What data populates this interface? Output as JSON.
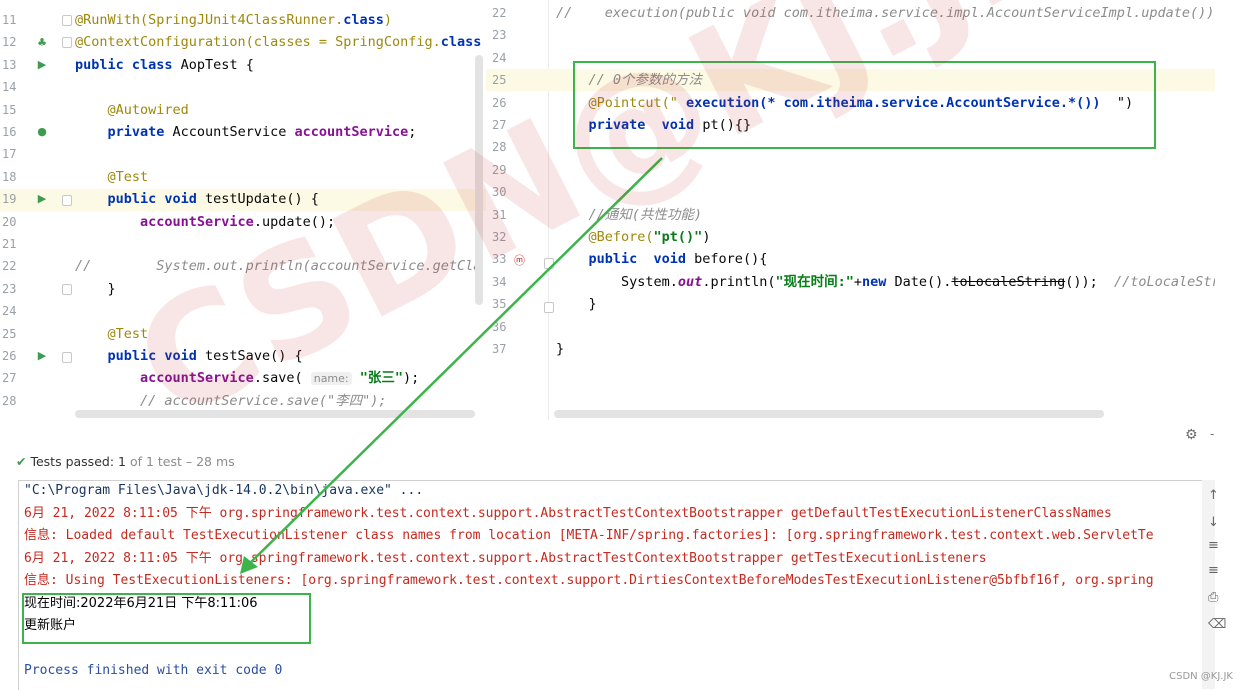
{
  "left_editor": {
    "lines": [
      {
        "num": "11",
        "parts": [
          {
            "t": "@RunWith(SpringJUnit4ClassRunner.",
            "c": "ann"
          },
          {
            "t": "class",
            "c": "kw"
          },
          {
            "t": ")",
            "c": "ann"
          }
        ]
      },
      {
        "num": "12",
        "parts": [
          {
            "t": "@ContextConfiguration(classes = SpringConfig.",
            "c": "ann"
          },
          {
            "t": "class",
            "c": "kw"
          }
        ]
      },
      {
        "num": "13",
        "parts": [
          {
            "t": "public class ",
            "c": "kw"
          },
          {
            "t": "AopTest {",
            "c": ""
          }
        ]
      },
      {
        "num": "14",
        "parts": []
      },
      {
        "num": "15",
        "parts": [
          {
            "t": "    @Autowired",
            "c": "ann"
          }
        ]
      },
      {
        "num": "16",
        "parts": [
          {
            "t": "    private ",
            "c": "kw"
          },
          {
            "t": "AccountService ",
            "c": ""
          },
          {
            "t": "accountService",
            "c": "fld"
          },
          {
            "t": ";",
            "c": ""
          }
        ]
      },
      {
        "num": "17",
        "parts": []
      },
      {
        "num": "18",
        "parts": [
          {
            "t": "    @Test",
            "c": "ann"
          }
        ]
      },
      {
        "num": "19",
        "parts": [
          {
            "t": "    public void ",
            "c": "kw"
          },
          {
            "t": "testUpdate() {",
            "c": ""
          }
        ]
      },
      {
        "num": "20",
        "parts": [
          {
            "t": "        accountService",
            "c": "fld"
          },
          {
            "t": ".update();",
            "c": ""
          }
        ]
      },
      {
        "num": "21",
        "parts": []
      },
      {
        "num": "22",
        "parts": [
          {
            "t": "//        System.out.println(accountService.getCla",
            "c": "cmt"
          }
        ]
      },
      {
        "num": "23",
        "parts": [
          {
            "t": "    }",
            "c": ""
          }
        ]
      },
      {
        "num": "24",
        "parts": []
      },
      {
        "num": "25",
        "parts": [
          {
            "t": "    @Test",
            "c": "ann"
          }
        ]
      },
      {
        "num": "26",
        "parts": [
          {
            "t": "    public void ",
            "c": "kw"
          },
          {
            "t": "testSave() {",
            "c": ""
          }
        ]
      },
      {
        "num": "27",
        "parts": [
          {
            "t": "        accountService",
            "c": "fld"
          },
          {
            "t": ".save( ",
            "c": ""
          },
          {
            "t": "name:",
            "c": "hint"
          },
          {
            "t": " \"张三\"",
            "c": "str"
          },
          {
            "t": ");",
            "c": ""
          }
        ]
      },
      {
        "num": "28",
        "parts": [
          {
            "t": "        // accountService.save(\"李四\");",
            "c": "cmt"
          }
        ]
      }
    ]
  },
  "right_editor": {
    "lines": [
      {
        "num": "22",
        "parts": [
          {
            "t": "//    execution(public void com.itheima.service.impl.AccountServiceImpl.update())",
            "c": "cmt"
          }
        ]
      },
      {
        "num": "23",
        "parts": []
      },
      {
        "num": "24",
        "parts": []
      },
      {
        "num": "25",
        "parts": [
          {
            "t": "    // 0个参数的方法",
            "c": "cmt"
          }
        ]
      },
      {
        "num": "26",
        "parts": [
          {
            "t": "    @Pointcut(\"",
            "c": "ann"
          },
          {
            "t": " execution(* com.itheima.service.AccountService.*())  ",
            "c": "kw"
          },
          {
            "t": "\")",
            "c": ""
          }
        ]
      },
      {
        "num": "27",
        "parts": [
          {
            "t": "    private  void ",
            "c": "kw"
          },
          {
            "t": "pt(){}",
            "c": ""
          }
        ]
      },
      {
        "num": "28",
        "parts": []
      },
      {
        "num": "29",
        "parts": []
      },
      {
        "num": "30",
        "parts": []
      },
      {
        "num": "31",
        "parts": [
          {
            "t": "    //通知(共性功能)",
            "c": "cmt"
          }
        ]
      },
      {
        "num": "32",
        "parts": [
          {
            "t": "    @Before(",
            "c": "ann"
          },
          {
            "t": "\"pt()\"",
            "c": "str"
          },
          {
            "t": ")",
            "c": ""
          }
        ]
      },
      {
        "num": "33",
        "parts": [
          {
            "t": "    public  void ",
            "c": "kw"
          },
          {
            "t": "before(){",
            "c": ""
          }
        ]
      },
      {
        "num": "34",
        "parts": [
          {
            "t": "        System.",
            "c": ""
          },
          {
            "t": "out",
            "c": "fld italic"
          },
          {
            "t": ".println(",
            "c": ""
          },
          {
            "t": "\"现在时间:\"",
            "c": "str"
          },
          {
            "t": "+",
            "c": ""
          },
          {
            "t": "new ",
            "c": "kw"
          },
          {
            "t": "Date().",
            "c": ""
          },
          {
            "t": "toLocaleString",
            "c": "strike"
          },
          {
            "t": "());  ",
            "c": ""
          },
          {
            "t": "//toLocaleStr",
            "c": "cmt"
          }
        ]
      },
      {
        "num": "35",
        "parts": [
          {
            "t": "    }",
            "c": ""
          }
        ]
      },
      {
        "num": "36",
        "parts": []
      },
      {
        "num": "37",
        "parts": [
          {
            "t": "}",
            "c": ""
          }
        ]
      }
    ]
  },
  "test_status": {
    "check": "✔",
    "label": "Tests passed:",
    "count": "1",
    "rest": "of 1 test – 28 ms"
  },
  "console": {
    "lines": [
      {
        "text": "\"C:\\Program Files\\Java\\jdk-14.0.2\\bin\\java.exe\" ...",
        "c": "dark"
      },
      {
        "text": "6月 21, 2022 8:11:05 下午 org.springframework.test.context.support.AbstractTestContextBootstrapper getDefaultTestExecutionListenerClassNames",
        "c": "red"
      },
      {
        "text": "信息: Loaded default TestExecutionListener class names from location [META-INF/spring.factories]: [org.springframework.test.context.web.ServletTe",
        "c": "red"
      },
      {
        "text": "6月 21, 2022 8:11:05 下午 org.springframework.test.context.support.AbstractTestContextBootstrapper getTestExecutionListeners",
        "c": "red"
      },
      {
        "text": "信息: Using TestExecutionListeners: [org.springframework.test.context.support.DirtiesContextBeforeModesTestExecutionListener@5bfbf16f, org.spring",
        "c": "red"
      },
      {
        "text": "现在时间:2022年6月21日 下午8:11:06",
        "c": "plain-cn"
      },
      {
        "text": "更新账户",
        "c": "plain-cn"
      },
      {
        "text": "",
        "c": ""
      },
      {
        "text": "Process finished with exit code 0",
        "c": "blue"
      }
    ]
  },
  "watermark": "CSDN@KJ.JK",
  "footer_credit": "CSDN @KJ.JK"
}
